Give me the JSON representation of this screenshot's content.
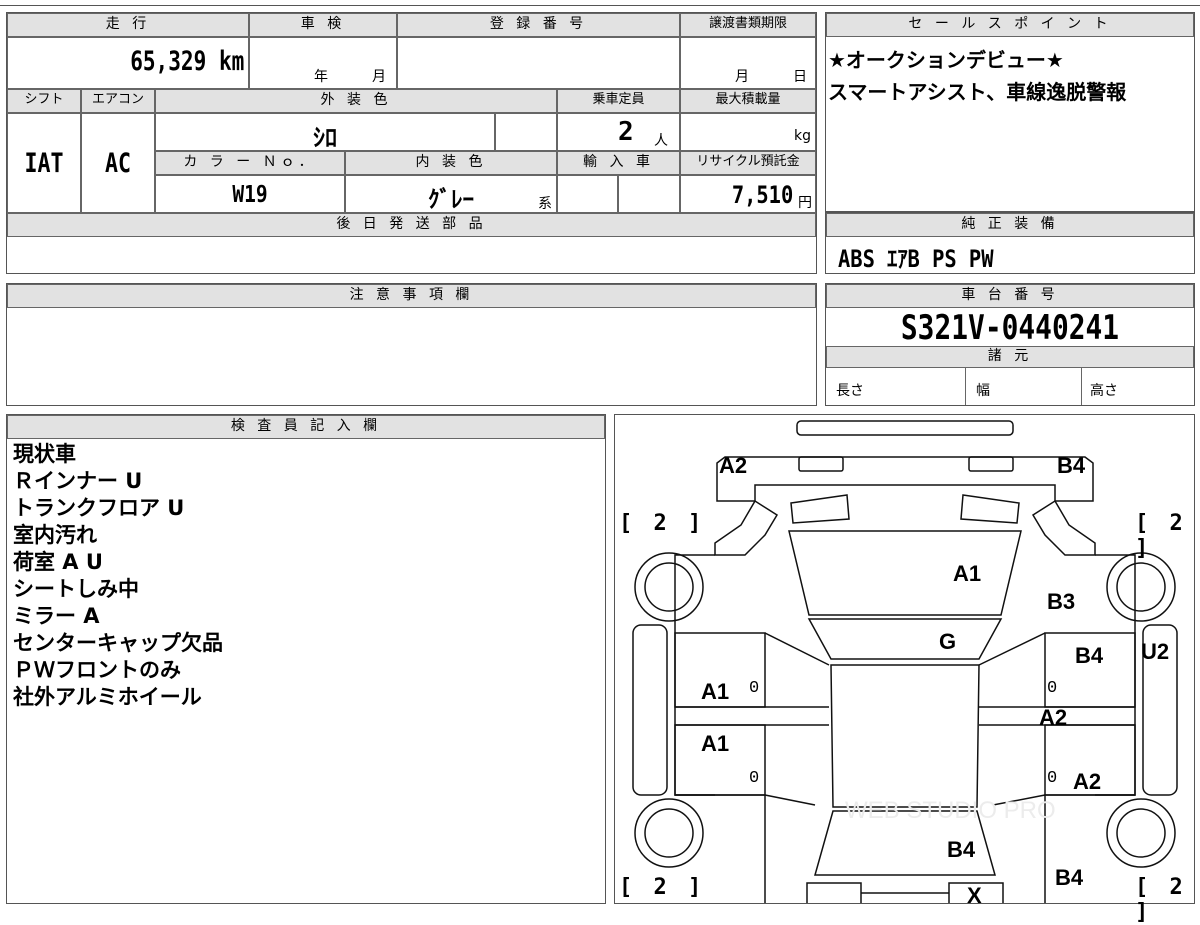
{
  "top": {
    "mileage_header": "走 行",
    "mileage_value": "65,329 km",
    "shaken_header": "車 検",
    "shaken_year": "年",
    "shaken_month": "月",
    "reg_header": "登 録 番 号",
    "transfer_header": "譲渡書類期限",
    "transfer_month": "月",
    "transfer_day": "日",
    "shift_header": "シフト",
    "shift_value": "IAT",
    "ac_header": "エアコン",
    "ac_value": "AC",
    "color_header": "外 装 色",
    "color_value": "ｼﾛ",
    "capacity_header": "乗車定員",
    "capacity_value": "2",
    "capacity_unit": "人",
    "load_header": "最大積載量",
    "load_unit": "kg",
    "colorno_header": "カ ラ ー Ｎｏ．",
    "colorno_value": "W19",
    "interior_header": "内 装 色",
    "interior_value": "ｸﾞﾚｰ",
    "interior_suffix": "系",
    "import_header": "輸 入 車",
    "recycle_header": "リサイクル預託金",
    "recycle_value": "7,510",
    "recycle_unit": "円",
    "later_parts_header": "後 日 発 送 部 品"
  },
  "sales": {
    "header": "セ ー ル ス ポ イ ン ト",
    "lines": [
      "★オークションデビュー★",
      "スマートアシスト、車線逸脱警報"
    ]
  },
  "equipment": {
    "header": "純 正 装 備",
    "value": "ABS ｴｱB PS PW"
  },
  "notes": {
    "header": "注 意 事 項 欄"
  },
  "chassis": {
    "header": "車 台 番 号",
    "value": "S321V-0440241",
    "spec_header": "諸 元",
    "length_label": "長さ",
    "width_label": "幅",
    "height_label": "高さ"
  },
  "inspector": {
    "header": "検 査 員 記 入 欄",
    "lines": [
      "現状車",
      "Ｒインナー U",
      "トランクフロア U",
      "室内汚れ",
      "荷室 A U",
      "シートしみ中",
      "ミラー A",
      "センターキャップ欠品",
      "ＰＷフロントのみ",
      "社外アルミホイール"
    ]
  },
  "diagram": {
    "labels": {
      "a2_front_left": "A2",
      "b4_front_right": "B4",
      "a1_hood": "A1",
      "b3_fender": "B3",
      "g_windshield": "G",
      "b4_front_door_right": "B4",
      "u2_side": "U2",
      "a1_front_door_left": "A1",
      "a2_pillar_right": "A2",
      "a1_rear_door_left": "A1",
      "a2_rear_door_right": "A2",
      "b4_rear": "B4",
      "b4_rear_quarter": "B4",
      "x_bumper": "X"
    },
    "zero": "0",
    "tire_depth": "[ 2 ]",
    "watermark": "WEB STUDIO PRO"
  }
}
